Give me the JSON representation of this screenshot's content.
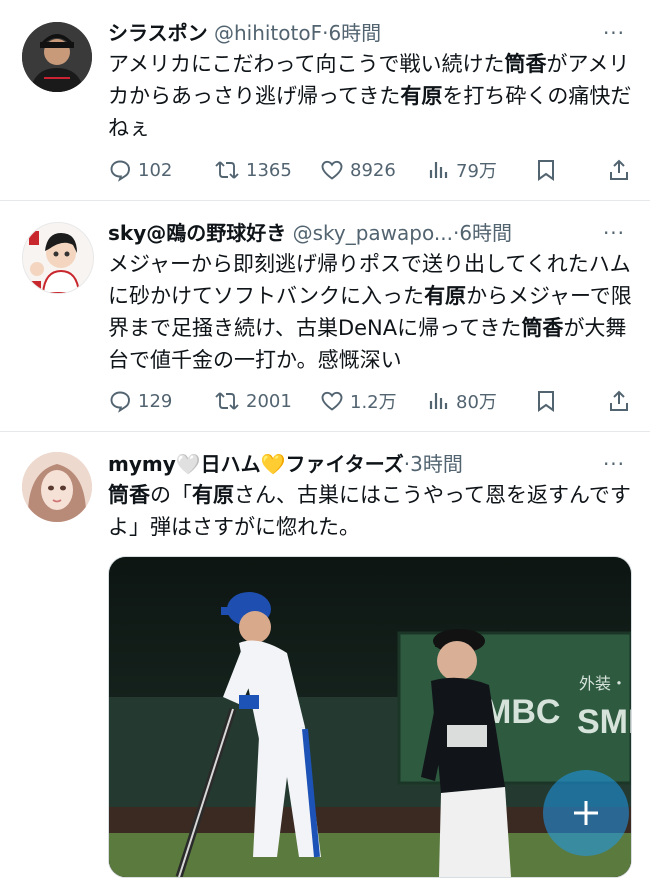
{
  "tweets": [
    {
      "name": "シラスポン",
      "handle": "@hihitotoF",
      "dot": "·",
      "time": "6時間",
      "text": [
        [
          "アメリカにこだわって向こうで戦い続けた"
        ],
        [
          "筒香",
          true
        ],
        [
          "がアメリカからあっさり逃げ帰ってきた"
        ],
        [
          "有原",
          true
        ],
        [
          "を打ち砕くの痛快だねぇ"
        ]
      ],
      "stats": {
        "replies": "102",
        "retweets": "1365",
        "likes": "8926",
        "views": "79万"
      }
    },
    {
      "name": "sky@鴎の野球好き",
      "handle": "@sky_pawapo...",
      "dot": "·",
      "time": "6時間",
      "text": [
        [
          "メジャーから即刻逃げ帰りポスで送り出してくれたハムに砂かけてソフトバンクに入った"
        ],
        [
          "有原",
          true
        ],
        [
          "からメジャーで限界まで足掻き続け、古巣DeNAに帰ってきた"
        ],
        [
          "筒香",
          true
        ],
        [
          "が大舞台で値千金の一打か。感慨深い"
        ]
      ],
      "stats": {
        "replies": "129",
        "retweets": "2001",
        "likes": "1.2万",
        "views": "80万"
      }
    },
    {
      "name": "mymy🤍日ハム💛ファイターズ",
      "handle": "",
      "dot": "·",
      "time": "3時間",
      "text": [
        [
          "筒香",
          true
        ],
        [
          "の「"
        ],
        [
          "有原",
          true
        ],
        [
          "さん、古巣にはこうやって恩を返すんですよ」弾はさすがに惚れた。"
        ]
      ]
    }
  ],
  "media": {
    "ad_board_1": "MBC",
    "ad_board_2": "SMI",
    "ad_board_3": "外装・"
  },
  "colors": {
    "text": "#0f1419",
    "secondary": "#536471",
    "fab": "#1d9bf0"
  }
}
